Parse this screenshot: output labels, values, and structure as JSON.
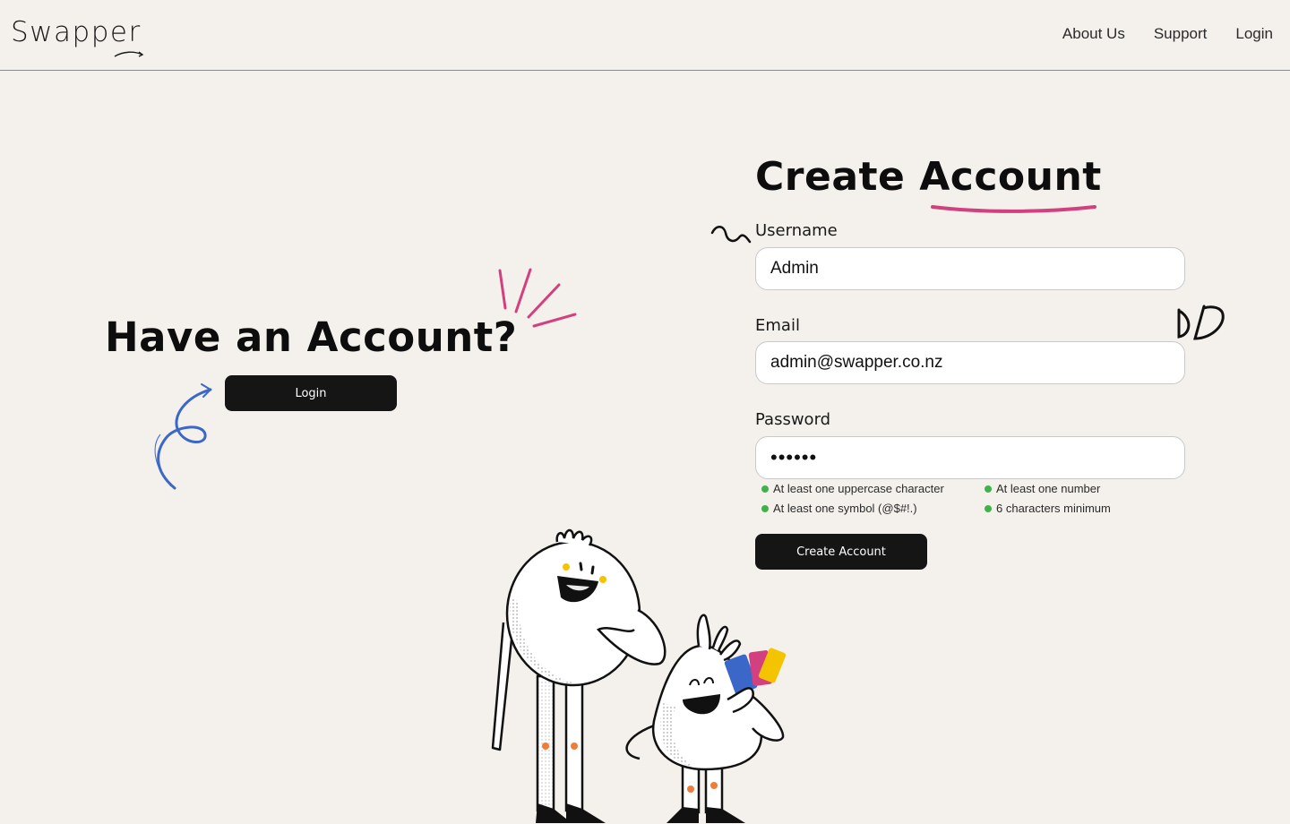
{
  "header": {
    "logo": "Swapper",
    "nav": [
      {
        "label": "About Us"
      },
      {
        "label": "Support"
      },
      {
        "label": "Login"
      }
    ]
  },
  "login_panel": {
    "title": "Have an Account?",
    "button_label": "Login"
  },
  "signup_form": {
    "title": "Create Account",
    "username": {
      "label": "Username",
      "value": "Admin"
    },
    "email": {
      "label": "Email",
      "value": "admin@swapper.co.nz"
    },
    "password": {
      "label": "Password",
      "value": "••••••"
    },
    "rules": [
      {
        "text": "At least one uppercase character",
        "met": true
      },
      {
        "text": "At least one number",
        "met": true
      },
      {
        "text": "At least one symbol (@$#!.)",
        "met": true
      },
      {
        "text": "6 characters minimum",
        "met": true
      }
    ],
    "submit_label": "Create Account"
  },
  "colors": {
    "background": "#f4f1ec",
    "button": "#151515",
    "accent_pink": "#d2407f",
    "accent_blue": "#3b68c8",
    "rule_ok": "#3fb34a"
  }
}
